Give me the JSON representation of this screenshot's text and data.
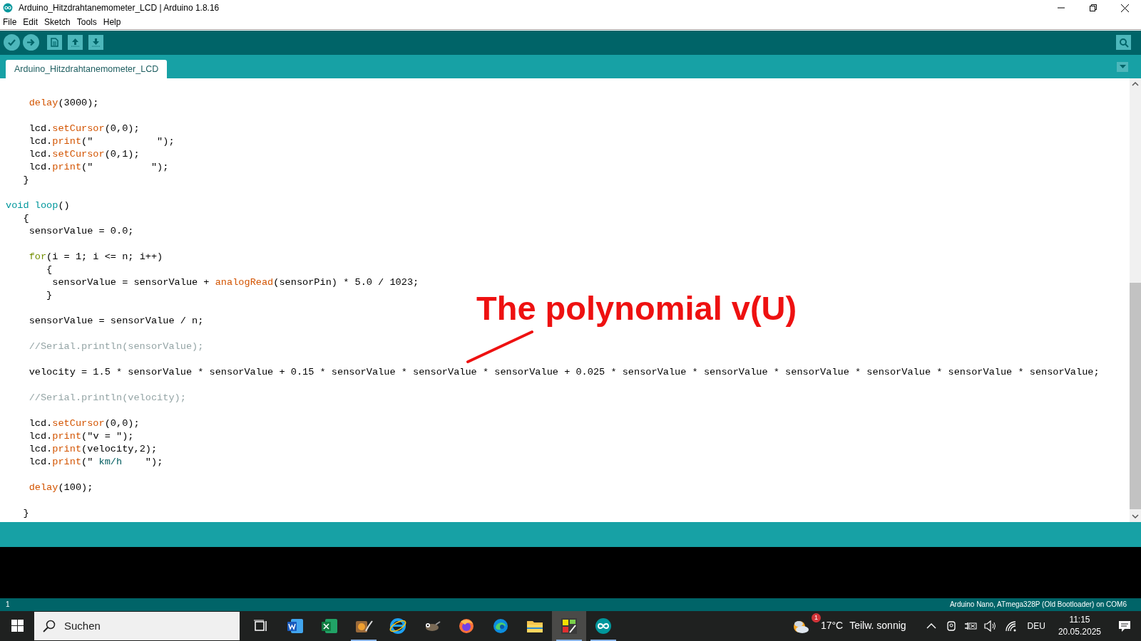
{
  "window": {
    "title": "Arduino_Hitzdrahtanemometer_LCD | Arduino 1.8.16"
  },
  "menu": [
    "File",
    "Edit",
    "Sketch",
    "Tools",
    "Help"
  ],
  "tabs": [
    {
      "label": "Arduino_Hitzdrahtanemometer_LCD",
      "selected": true
    }
  ],
  "code": [
    {
      "kind": "code",
      "tokens": [
        {
          "text": "    delay",
          "kind": "function"
        },
        {
          "text": "(3000);",
          "kind": "plain"
        }
      ]
    },
    {
      "kind": "blank"
    },
    {
      "kind": "code",
      "tokens": [
        {
          "text": "    lcd.",
          "kind": "plain"
        },
        {
          "text": "setCursor",
          "kind": "function"
        },
        {
          "text": "(0,0);",
          "kind": "plain"
        }
      ]
    },
    {
      "kind": "code",
      "tokens": [
        {
          "text": "    lcd.",
          "kind": "plain"
        },
        {
          "text": "print",
          "kind": "function"
        },
        {
          "text": "(\"           \");",
          "kind": "plain"
        }
      ]
    },
    {
      "kind": "code",
      "tokens": [
        {
          "text": "    lcd.",
          "kind": "plain"
        },
        {
          "text": "setCursor",
          "kind": "function"
        },
        {
          "text": "(0,1);",
          "kind": "plain"
        }
      ]
    },
    {
      "kind": "code",
      "tokens": [
        {
          "text": "    lcd.",
          "kind": "plain"
        },
        {
          "text": "print",
          "kind": "function"
        },
        {
          "text": "(\"          \");",
          "kind": "plain"
        }
      ]
    },
    {
      "kind": "code",
      "tokens": [
        {
          "text": "   }",
          "kind": "plain"
        }
      ]
    },
    {
      "kind": "blank"
    },
    {
      "kind": "code",
      "tokens": [
        {
          "text": "void",
          "kind": "keyword"
        },
        {
          "text": " loop",
          "kind": "keyword"
        },
        {
          "text": "()",
          "kind": "plain"
        }
      ]
    },
    {
      "kind": "code",
      "tokens": [
        {
          "text": "   {",
          "kind": "plain"
        }
      ]
    },
    {
      "kind": "code",
      "tokens": [
        {
          "text": "    sensorValue = 0.0;",
          "kind": "plain"
        }
      ]
    },
    {
      "kind": "blank"
    },
    {
      "kind": "code",
      "tokens": [
        {
          "text": "    for",
          "kind": "control"
        },
        {
          "text": "(i = 1; i <= n; i++)",
          "kind": "plain"
        }
      ]
    },
    {
      "kind": "code",
      "tokens": [
        {
          "text": "       {",
          "kind": "plain"
        }
      ]
    },
    {
      "kind": "code",
      "tokens": [
        {
          "text": "        sensorValue = sensorValue + ",
          "kind": "plain"
        },
        {
          "text": "analogRead",
          "kind": "function"
        },
        {
          "text": "(sensorPin) * 5.0 / 1023;",
          "kind": "plain"
        }
      ]
    },
    {
      "kind": "code",
      "tokens": [
        {
          "text": "       }",
          "kind": "plain"
        }
      ]
    },
    {
      "kind": "blank"
    },
    {
      "kind": "code",
      "tokens": [
        {
          "text": "    sensorValue = sensorValue / n;",
          "kind": "plain"
        }
      ]
    },
    {
      "kind": "blank"
    },
    {
      "kind": "code",
      "tokens": [
        {
          "text": "    //Serial.println(sensorValue);",
          "kind": "comment"
        }
      ]
    },
    {
      "kind": "blank"
    },
    {
      "kind": "code",
      "tokens": [
        {
          "text": "    velocity = 1.5 * sensorValue * sensorValue + 0.15 * sensorValue * sensorValue * sensorValue + 0.025 * sensorValue * sensorValue * sensorValue * sensorValue * sensorValue * sensorValue;",
          "kind": "plain"
        }
      ]
    },
    {
      "kind": "blank"
    },
    {
      "kind": "code",
      "tokens": [
        {
          "text": "    //Serial.println(velocity);",
          "kind": "comment"
        }
      ]
    },
    {
      "kind": "blank"
    },
    {
      "kind": "code",
      "tokens": [
        {
          "text": "    lcd.",
          "kind": "plain"
        },
        {
          "text": "setCursor",
          "kind": "function"
        },
        {
          "text": "(0,0);",
          "kind": "plain"
        }
      ]
    },
    {
      "kind": "code",
      "tokens": [
        {
          "text": "    lcd.",
          "kind": "plain"
        },
        {
          "text": "print",
          "kind": "function"
        },
        {
          "text": "(\"v = \");",
          "kind": "plain"
        }
      ]
    },
    {
      "kind": "code",
      "tokens": [
        {
          "text": "    lcd.",
          "kind": "plain"
        },
        {
          "text": "print",
          "kind": "function"
        },
        {
          "text": "(velocity,2);",
          "kind": "plain"
        }
      ]
    },
    {
      "kind": "code",
      "tokens": [
        {
          "text": "    lcd.",
          "kind": "plain"
        },
        {
          "text": "print",
          "kind": "function"
        },
        {
          "text": "(\"",
          "kind": "plain"
        },
        {
          "text": " km/h    ",
          "kind": "string"
        },
        {
          "text": "\");",
          "kind": "plain"
        }
      ]
    },
    {
      "kind": "blank"
    },
    {
      "kind": "code",
      "tokens": [
        {
          "text": "    delay",
          "kind": "function"
        },
        {
          "text": "(100);",
          "kind": "plain"
        }
      ]
    },
    {
      "kind": "blank"
    },
    {
      "kind": "code",
      "tokens": [
        {
          "text": "   }",
          "kind": "plain"
        }
      ]
    }
  ],
  "annotation": {
    "text": "The polynomial v(U)"
  },
  "status_bar": {
    "line": "1",
    "board": "Arduino Nano, ATmega328P (Old Bootloader) on COM6"
  },
  "taskbar": {
    "search": {
      "placeholder": "Suchen"
    },
    "apps": [
      {
        "kind": "taskview",
        "running": false,
        "selected": false
      },
      {
        "kind": "word",
        "running": false,
        "selected": false
      },
      {
        "kind": "excel",
        "running": false,
        "selected": false
      },
      {
        "kind": "film",
        "running": true,
        "selected": false
      },
      {
        "kind": "ie",
        "running": false,
        "selected": false
      },
      {
        "kind": "gimp",
        "running": false,
        "selected": false
      },
      {
        "kind": "firefox",
        "running": false,
        "selected": false
      },
      {
        "kind": "edge",
        "running": false,
        "selected": false
      },
      {
        "kind": "folder",
        "running": false,
        "selected": false
      },
      {
        "kind": "circuit",
        "running": true,
        "selected": true
      },
      {
        "kind": "arduino",
        "running": true,
        "selected": false
      }
    ],
    "weather": {
      "badge": "1",
      "temperature": "17°C",
      "condition": "Teilw. sonnig"
    },
    "language": "DEU",
    "time": "11:15",
    "date": "20.05.2025"
  }
}
